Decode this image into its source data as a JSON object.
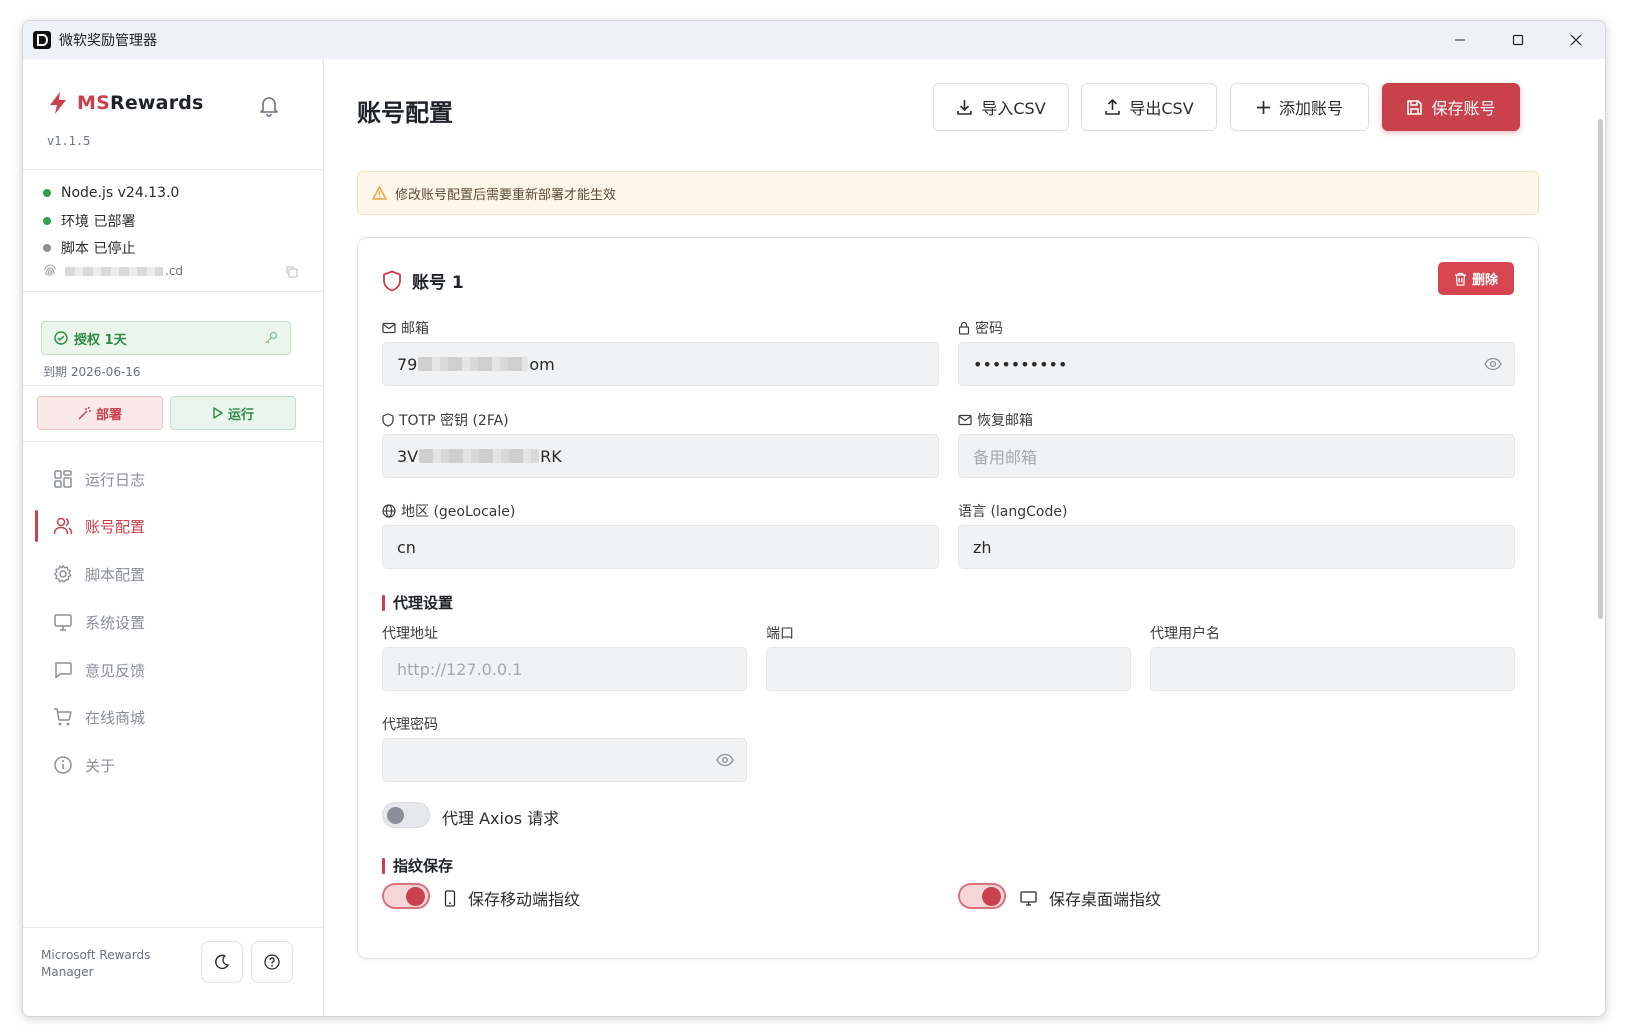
{
  "window": {
    "title": "微软奖励管理器"
  },
  "sidebar": {
    "brand_ms": "MS",
    "brand_rewards": "Rewards",
    "version": "v1.1.5",
    "status": [
      {
        "text": "Node.js v24.13.0",
        "color": "#2e9e4f"
      },
      {
        "text": "环境 已部署",
        "color": "#2e9e4f"
      },
      {
        "text": "脚本 已停止",
        "color": "#8a8f98"
      }
    ],
    "machine_suffix": ".cd",
    "license": "授权 1天",
    "expire": "到期 2026-06-16",
    "deploy_label": "部署",
    "run_label": "运行",
    "nav": [
      {
        "label": "运行日志",
        "icon": "dashboard-icon",
        "active": false
      },
      {
        "label": "账号配置",
        "icon": "users-icon",
        "active": true
      },
      {
        "label": "脚本配置",
        "icon": "gear-icon",
        "active": false
      },
      {
        "label": "系统设置",
        "icon": "monitor-icon",
        "active": false
      },
      {
        "label": "意见反馈",
        "icon": "message-icon",
        "active": false
      },
      {
        "label": "在线商城",
        "icon": "cart-icon",
        "active": false
      },
      {
        "label": "关于",
        "icon": "info-icon",
        "active": false
      }
    ],
    "footer": "Microsoft Rewards Manager"
  },
  "main": {
    "title": "账号配置",
    "toolbar": {
      "import": "导入CSV",
      "export": "导出CSV",
      "add": "添加账号",
      "save": "保存账号"
    },
    "warning": "修改账号配置后需要重新部署才能生效",
    "account": {
      "title": "账号 1",
      "delete": "删除",
      "email_label": "邮箱",
      "email_prefix": "79",
      "email_suffix": "om",
      "password_label": "密码",
      "password_value": "••••••••••",
      "totp_label": "TOTP 密钥 (2FA)",
      "totp_prefix": "3V",
      "totp_suffix": "RK",
      "recovery_label": "恢复邮箱",
      "recovery_placeholder": "备用邮箱",
      "geo_label": "地区 (geoLocale)",
      "geo_value": "cn",
      "lang_label": "语言 (langCode)",
      "lang_value": "zh",
      "proxy_section": "代理设置",
      "proxy_url_label": "代理地址",
      "proxy_url_placeholder": "http://127.0.0.1",
      "port_label": "端口",
      "proxy_user_label": "代理用户名",
      "proxy_pass_label": "代理密码",
      "axios_label": "代理 Axios 请求",
      "axios_on": false,
      "fingerprint_section": "指纹保存",
      "mobile_fp_label": "保存移动端指纹",
      "mobile_fp_on": true,
      "desktop_fp_label": "保存桌面端指纹",
      "desktop_fp_on": true
    }
  },
  "colors": {
    "accent": "#c8414b",
    "success": "#2e8b45",
    "warning_bg": "#fff6ea"
  }
}
